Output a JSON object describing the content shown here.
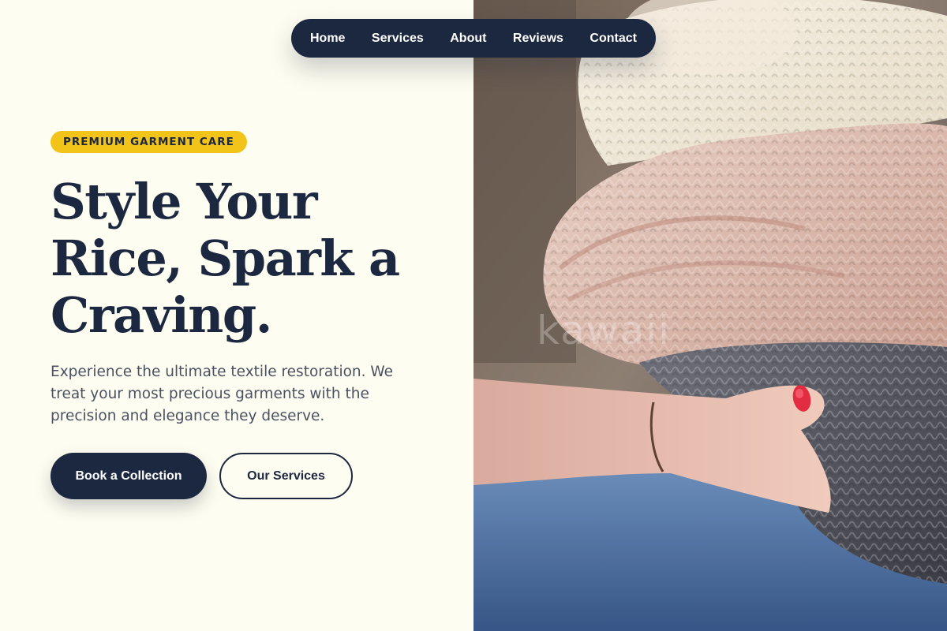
{
  "nav": {
    "items": [
      {
        "label": "Home"
      },
      {
        "label": "Services"
      },
      {
        "label": "About"
      },
      {
        "label": "Reviews"
      },
      {
        "label": "Contact"
      }
    ]
  },
  "hero": {
    "badge": "PREMIUM GARMENT CARE",
    "headline_line1": "Style Your",
    "headline_line2": "Rice, Spark a",
    "headline_line3": "Craving.",
    "subtext": "Experience the ultimate textile restoration. We treat your most precious garments with the precision and elegance they deserve.",
    "primary_button": "Book a Collection",
    "secondary_button": "Our Services"
  },
  "image": {
    "watermark": "kawaii"
  },
  "colors": {
    "navy": "#1c2740",
    "accent_yellow": "#f2c318",
    "background": "#fefdf1"
  }
}
